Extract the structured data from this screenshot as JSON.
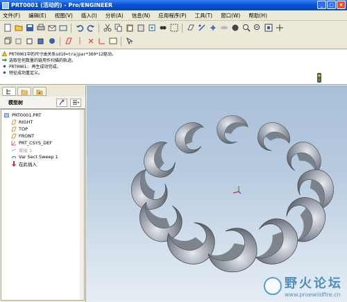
{
  "window": {
    "title": "PRT0001 (活动的) - Pro/ENGINEER"
  },
  "menu": {
    "items": [
      "文件(F)",
      "编辑(E)",
      "视图(V)",
      "插入(I)",
      "分析(A)",
      "信息(N)",
      "应用程序(P)",
      "工具(T)",
      "窗口(W)",
      "帮助(H)"
    ]
  },
  "messages": [
    {
      "icon": "warning-icon",
      "text": "PRT0001中的尺寸由关系sd10=trajpar*360*12驱动。"
    },
    {
      "icon": "arrow-icon",
      "text": "选取任何数量的链用作扫描的轨迹。"
    },
    {
      "icon": "dot-icon",
      "text": "PRT0001: 再生成功完成。"
    },
    {
      "icon": "dot-icon",
      "text": "特征成功重定义。"
    }
  ],
  "model_tree": {
    "header": "模型树",
    "items": [
      {
        "label": "PRT0001.PRT",
        "icon": "part-icon",
        "indent": 0,
        "disabled": false
      },
      {
        "label": "RIGHT",
        "icon": "datum-plane-icon",
        "indent": 1,
        "disabled": false
      },
      {
        "label": "TOP",
        "icon": "datum-plane-icon",
        "indent": 1,
        "disabled": false
      },
      {
        "label": "FRONT",
        "icon": "datum-plane-icon",
        "indent": 1,
        "disabled": false
      },
      {
        "label": "PRT_CSYS_DEF",
        "icon": "csys-icon",
        "indent": 1,
        "disabled": false
      },
      {
        "label": "草绘 1",
        "icon": "sketch-icon",
        "indent": 1,
        "disabled": true
      },
      {
        "label": "Var Sect Sweep 1",
        "icon": "sweep-icon",
        "indent": 1,
        "disabled": false
      },
      {
        "label": "在此插入",
        "icon": "insert-arrow-icon",
        "indent": 1,
        "disabled": false
      }
    ]
  },
  "watermark": {
    "title": "野火论坛",
    "url": "www.proewildfire.cn"
  },
  "colors": {
    "title_bar": "#0a53d6",
    "viewport_top": "#a9bfd8",
    "viewport_bottom": "#e6edf4",
    "model_fill": "#8a8f99"
  }
}
